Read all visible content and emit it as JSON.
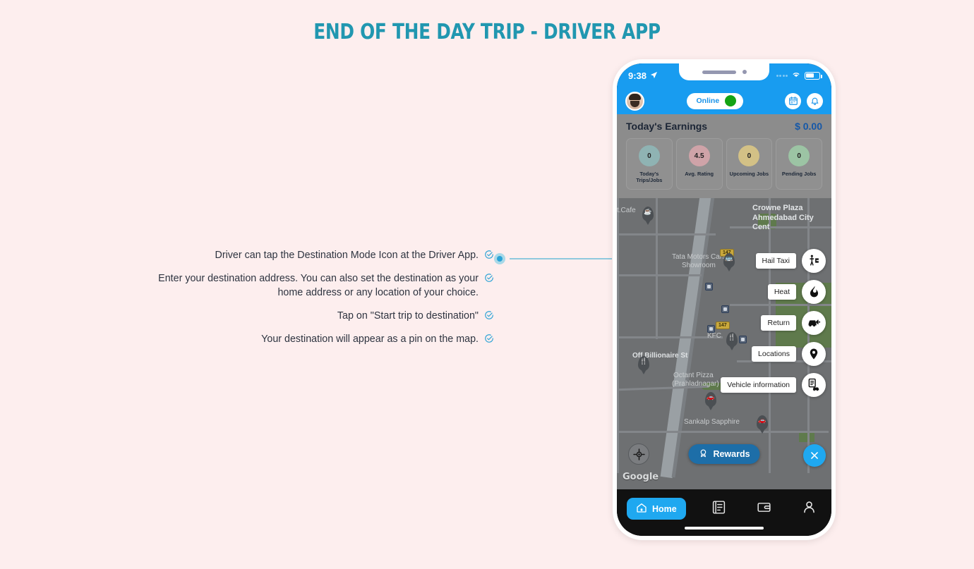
{
  "title": "END OF THE DAY TRIP - DRIVER APP",
  "accent_color": "#2197b0",
  "background_color": "#fdeeee",
  "bullets": [
    {
      "text": "Driver can tap the Destination Mode Icon at the Driver App.",
      "icon": "check-circle-icon"
    },
    {
      "text": "Enter your destination address. You can also set the destination as your home address or any location of your choice.",
      "icon": "check-circle-icon"
    },
    {
      "text": "Tap on \"Start trip to destination\"",
      "icon": "check-circle-icon"
    },
    {
      "text": "Your destination will appear as a pin on the map.",
      "icon": "check-circle-icon"
    }
  ],
  "phone": {
    "status_bar": {
      "time": "9:38",
      "location_arrow": "location-arrow-icon",
      "wifi": "wifi-icon",
      "battery": "battery-icon"
    },
    "header": {
      "avatar": "driver-avatar",
      "online_label": "Online",
      "online_color": "#14a314",
      "calendar_icon": "calendar-icon",
      "bell_icon": "bell-icon",
      "bar_color": "#189cf0"
    },
    "earnings": {
      "label": "Today's Earnings",
      "value": "$ 0.00",
      "value_color": "#1558a8"
    },
    "stats": [
      {
        "value": "0",
        "label": "Today's\nTrips/Jobs",
        "label_line1": "Today's",
        "label_line2": "Trips/Jobs",
        "color": "#8fb3b3"
      },
      {
        "value": "4.5",
        "label": "Avg. Rating",
        "label_line1": "Avg. Rating",
        "label_line2": "",
        "color": "#cfa3a8"
      },
      {
        "value": "0",
        "label": "Upcoming Jobs",
        "label_line1": "Upcoming Jobs",
        "label_line2": "",
        "color": "#d3c186"
      },
      {
        "value": "0",
        "label": "Pending Jobs",
        "label_line1": "Pending Jobs",
        "label_line2": "",
        "color": "#9cc4a4"
      }
    ],
    "map": {
      "labels": [
        "t.Cafe",
        "Crowne Plaza",
        "Ahmedabad City Cent",
        "Tata Motors Cars",
        "Showroom",
        "Off Billionaire St",
        "Octant Pizza",
        "(Prahladnagar)",
        "KFC",
        "Sankalp Sapphire"
      ],
      "highway_shield": "147",
      "watermark": "Google",
      "locate_icon": "locate-crosshair-icon"
    },
    "fabs": [
      {
        "label": "Hail Taxi",
        "icon": "hail-taxi-icon"
      },
      {
        "label": "Heat",
        "icon": "flame-icon"
      },
      {
        "label": "Return",
        "icon": "return-car-icon"
      },
      {
        "label": "Locations",
        "icon": "map-pin-icon"
      },
      {
        "label": "Vehicle information",
        "icon": "vehicle-info-icon"
      }
    ],
    "rewards_button": {
      "label": "Rewards",
      "icon": "rewards-medal-icon",
      "color": "#1d6ea8"
    },
    "close_button": {
      "icon": "close-icon",
      "color": "#1fa8f0"
    },
    "bottom_nav": [
      {
        "label": "Home",
        "icon": "home-icon",
        "active": true
      },
      {
        "label": "",
        "icon": "tasks-icon",
        "active": false
      },
      {
        "label": "",
        "icon": "wallet-icon",
        "active": false
      },
      {
        "label": "",
        "icon": "profile-icon",
        "active": false
      }
    ]
  }
}
